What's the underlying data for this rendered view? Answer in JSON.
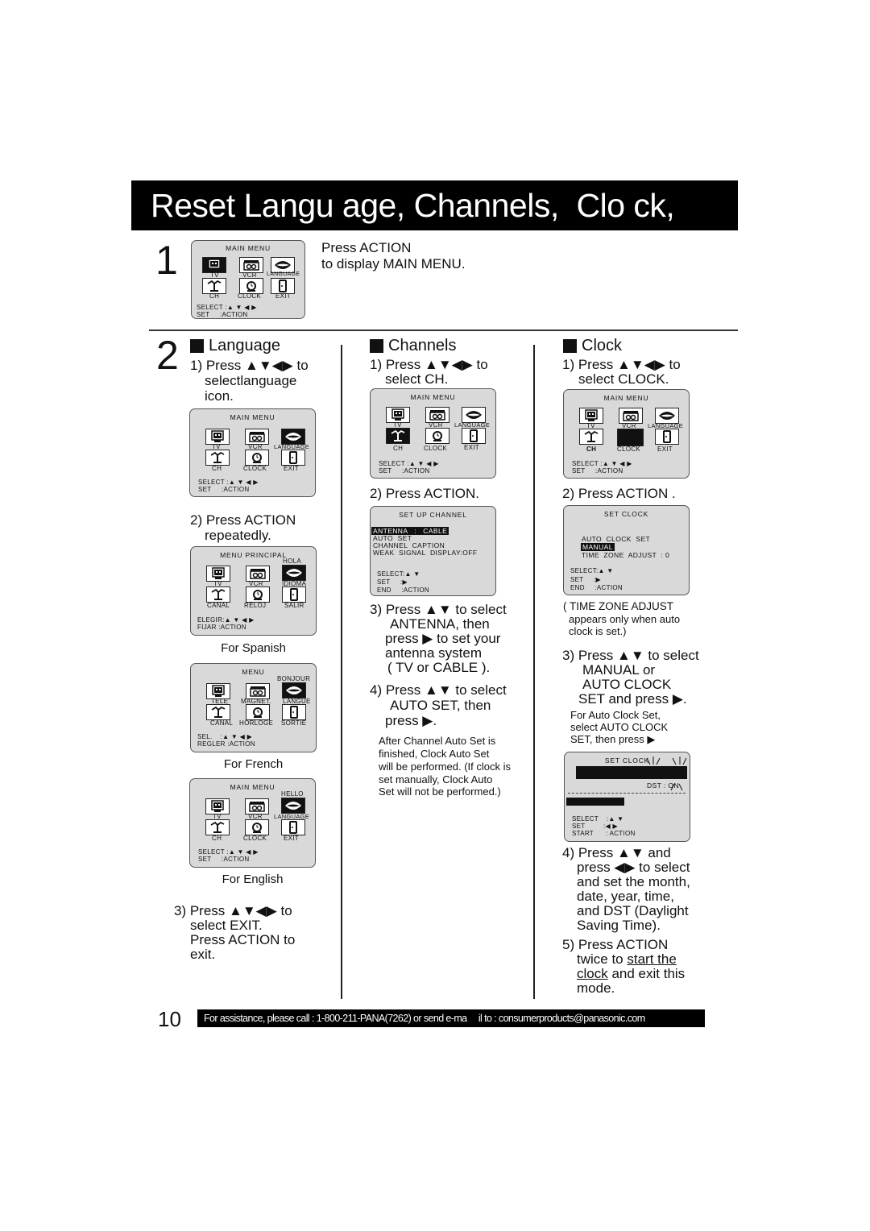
{
  "title": "Reset Langu age, Channels,  Clo ck,",
  "step1": {
    "number": "1",
    "line1": "Press ACTION",
    "line2": "to display MAIN MENU."
  },
  "step2": {
    "number": "2"
  },
  "osd_common": {
    "main_menu_title": "MAIN MENU",
    "tv": "TV",
    "vcr": "VCR",
    "language": "LANGUAGE",
    "ch": "CH",
    "clock": "CLOCK",
    "exit": "EXIT",
    "select_line": "SELECT :▲ ▼ ◀ ▶",
    "set_line": "SET     :ACTION",
    "icons": [
      "tv-icon",
      "vcr-icon",
      "language-lips-icon",
      "antenna-icon",
      "alarm-clock-icon",
      "exit-door-icon"
    ]
  },
  "language": {
    "heading": "Language",
    "step1_l1": "1) Press ▲▼◀▶ to",
    "step1_l2": "selectlanguage",
    "step1_l3": "icon.",
    "step2_l1": "2) Press ACTION",
    "step2_l2": "repeatedly.",
    "spanish": {
      "title": "MENU PRINCIPAL",
      "greeting": "HOLA",
      "tv": "TV",
      "vcr": "VCR",
      "language": "IDIOMA",
      "ch": "CANAL",
      "clock": "RELOJ",
      "exit": "SALIR",
      "select_line": "ELEGIR:▲ ▼ ◀ ▶",
      "set_line": "FIJAR :ACTION",
      "caption": "For Spanish"
    },
    "french": {
      "title": "MENU",
      "greeting": "BONJOUR",
      "tv": "TELE",
      "vcr": "MAGNET.",
      "language": "LANGUE",
      "ch": "CANAL",
      "clock": "HORLOGE",
      "exit": "SORTIE",
      "select_line": "SEL.    :▲ ▼ ◀ ▶",
      "set_line": "REGLER :ACTION",
      "caption": "For French"
    },
    "english": {
      "title": "MAIN MENU",
      "greeting": "HELLO",
      "tv": "TV",
      "vcr": "VCR",
      "language": "LANGUAGE",
      "ch": "CH",
      "clock": "CLOCK",
      "exit": "EXIT",
      "select_line": "SELECT :▲ ▼ ◀ ▶",
      "set_line": "SET     :ACTION",
      "caption": "For English"
    },
    "step3_l1": "3) Press ▲▼◀▶ to",
    "step3_l2": "select  EXIT.",
    "step3_l3": "Press ACTION  to",
    "step3_l4": "exit."
  },
  "channels": {
    "heading": "Channels",
    "step1_l1": "1) Press ▲▼◀▶ to",
    "step1_l2": "select  CH.",
    "step2": "2) Press ACTION.",
    "setup_screen": {
      "title": "SET  UP  CHANNEL",
      "antenna": "ANTENNA   :   CABLE",
      "auto_set": "AUTO  SET",
      "caption": "CHANNEL  CAPTION",
      "weak": "WEAK  SIGNAL  DISPLAY:OFF",
      "select": "SELECT:▲ ▼",
      "set": "SET     :▶",
      "end": "END     :ACTION"
    },
    "step3_l1": "3) Press ▲▼ to select",
    "step3_l2": "ANTENNA,  then",
    "step3_l3": "press  ▶ to set your",
    "step3_l4": "antenna system",
    "step3_l5": "( TV  or  CABLE ).",
    "step4_l1": "4) Press ▲▼ to select",
    "step4_l2": "AUTO SET,  then",
    "step4_l3": "press  ▶.",
    "note_l1": "After Channel Auto Set is",
    "note_l2": "finished, Clock Auto Set",
    "note_l3": "will be performed. (If clock is",
    "note_l4": "set manually, Clock Auto",
    "note_l5": "Set will not be performed.)"
  },
  "clock": {
    "heading": "Clock",
    "step1_l1": "1) Press ▲▼◀▶ to",
    "step1_l2": "select  CLOCK.",
    "step2": "2) Press ACTION .",
    "set_clock_screen": {
      "title": "SET  CLOCK",
      "auto": "AUTO  CLOCK  SET",
      "manual": "MANUAL",
      "tz": "TIME  ZONE  ADJUST  : 0",
      "select": "SELECT:▲ ▼",
      "set": "SET     :▶",
      "end": "END     :ACTION"
    },
    "tz_note_l1": "( TIME ZONE ADJUST",
    "tz_note_l2": "appears only when auto",
    "tz_note_l3": "clock is set.)",
    "step3_l1": "3) Press ▲▼ to select",
    "step3_l2": "MANUAL  or",
    "step3_l3": "AUTO CLOCK",
    "step3_l4": "SET  and press  ▶.",
    "auto_note_l1": "For Auto Clock Set,",
    "auto_note_l2": "select  AUTO CLOCK",
    "auto_note_l3": "SET,  then press   ▶",
    "manual_screen": {
      "title": "SET  CLOCK",
      "dst": "DST : ON",
      "select": "SELECT    :▲ ▼",
      "set": "SET         :◀ ▶",
      "start": "START      : ACTION"
    },
    "step4_l1": "4) Press ▲▼ and",
    "step4_l2": "press  ◀▶ to select",
    "step4_l3": "and set the month,",
    "step4_l4": "date, year, time,",
    "step4_l5": "and DST (Daylight",
    "step4_l6": "Saving Time).",
    "step5_l1": "5) Press ACTION",
    "step5_l2a": "twice to ",
    "step5_l2b": "start the",
    "step5_l3a": "clock",
    "step5_l3b": " and exit this",
    "step5_l4": "mode."
  },
  "footer": {
    "page_number": "10",
    "assistance": "For assistance, please call : 1-800-211-PANA(7262) or send e-ma     il to : consumerproducts@panasonic.com"
  }
}
